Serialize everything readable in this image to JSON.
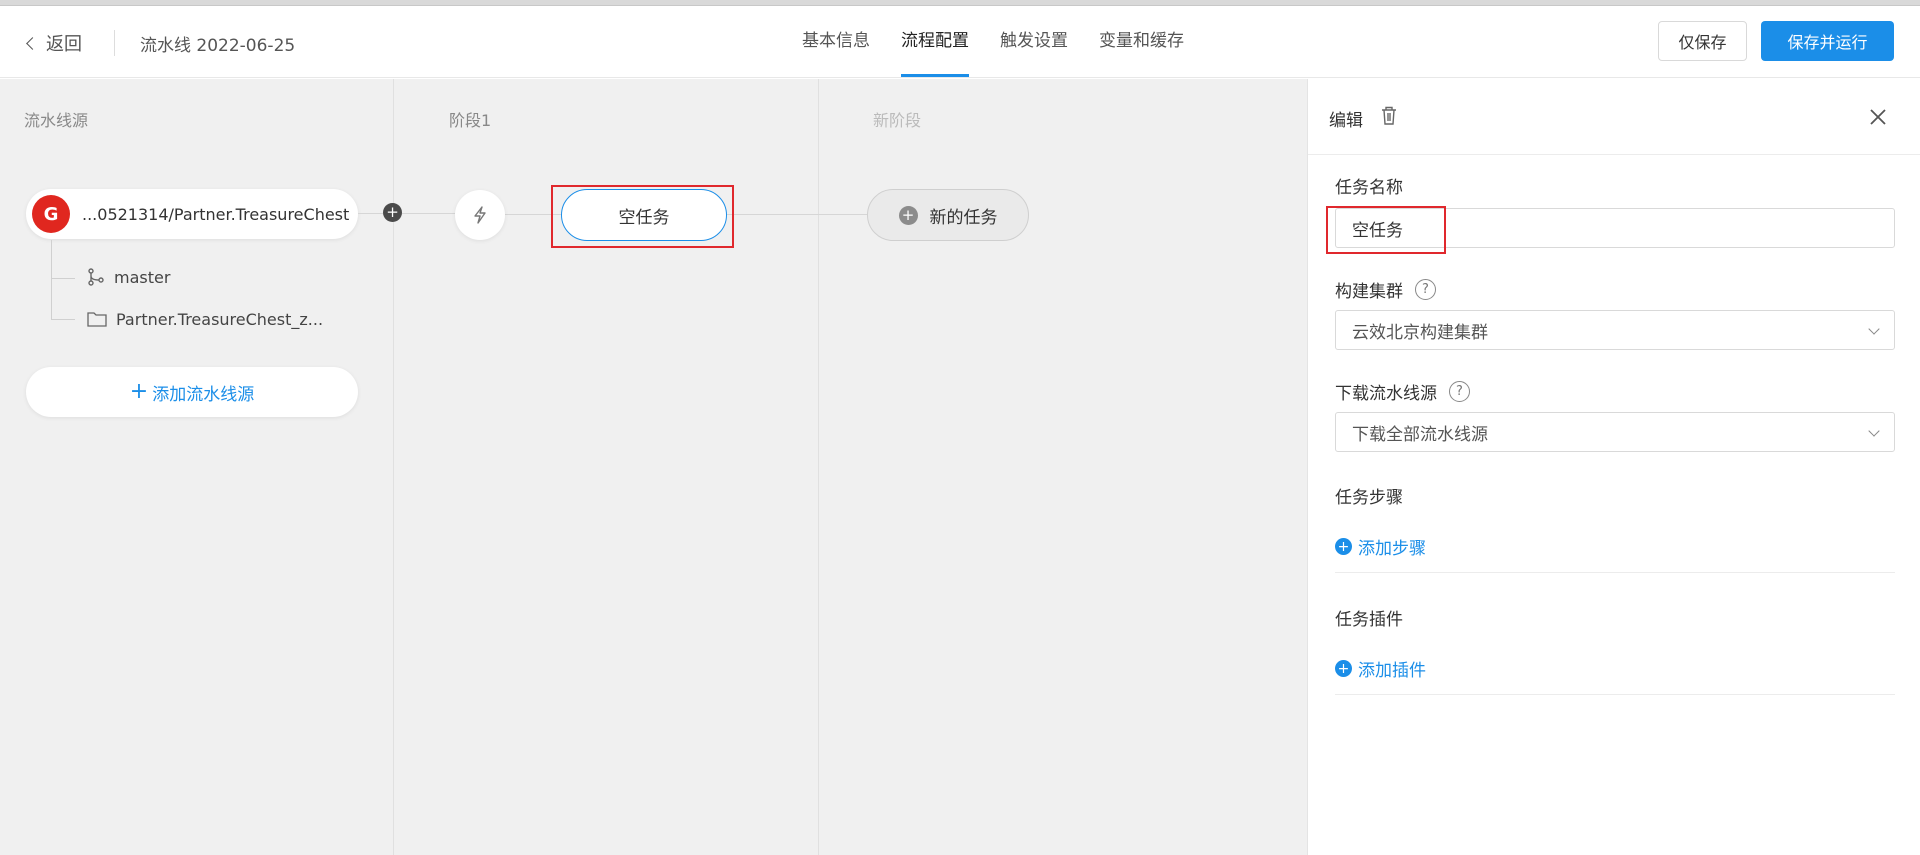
{
  "header": {
    "back_label": "返回",
    "pipeline_title": "流水线 2022-06-25",
    "tabs": [
      {
        "label": "基本信息",
        "active": false
      },
      {
        "label": "流程配置",
        "active": true
      },
      {
        "label": "触发设置",
        "active": false
      },
      {
        "label": "变量和缓存",
        "active": false
      }
    ],
    "save_only_label": "仅保存",
    "save_run_label": "保存并运行"
  },
  "canvas": {
    "columns": [
      {
        "title": "流水线源"
      },
      {
        "title": "阶段1"
      },
      {
        "title": "新阶段"
      }
    ],
    "source": {
      "logo_letter": "G",
      "name": "...0521314/Partner.TreasureChest",
      "branch": "master",
      "directory": "Partner.TreasureChest_z..."
    },
    "add_source_label": "添加流水线源",
    "task_label": "空任务",
    "new_task_label": "新的任务"
  },
  "panel": {
    "title": "编辑",
    "task_name_label": "任务名称",
    "task_name_value": "空任务",
    "build_cluster_label": "构建集群",
    "build_cluster_value": "云效北京构建集群",
    "download_source_label": "下载流水线源",
    "download_source_value": "下载全部流水线源",
    "steps_label": "任务步骤",
    "add_step_label": "添加步骤",
    "plugins_label": "任务插件",
    "add_plugin_label": "添加插件"
  },
  "colors": {
    "accent": "#1b8ee8",
    "highlight": "#e0282d",
    "source_logo": "#e0271f"
  }
}
